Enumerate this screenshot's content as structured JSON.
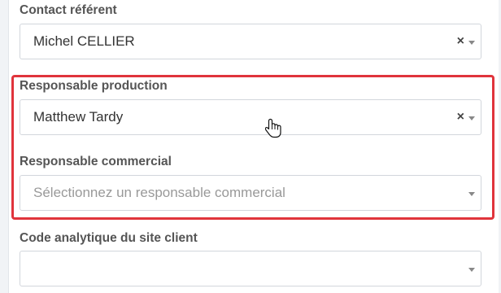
{
  "fields": [
    {
      "label": "Contact référent",
      "value": "Michel CELLIER",
      "clear_glyph": "×",
      "has_clear": true
    },
    {
      "label": "Responsable production",
      "value": "Matthew Tardy",
      "clear_glyph": "×",
      "has_clear": true
    },
    {
      "label": "Responsable commercial",
      "placeholder": "Sélectionnez un responsable commercial",
      "has_clear": false
    },
    {
      "label": "Code analytique du site client",
      "value": "",
      "has_clear": false
    }
  ],
  "highlight_color": "#e0343c",
  "cursor": "hand-pointer-icon"
}
